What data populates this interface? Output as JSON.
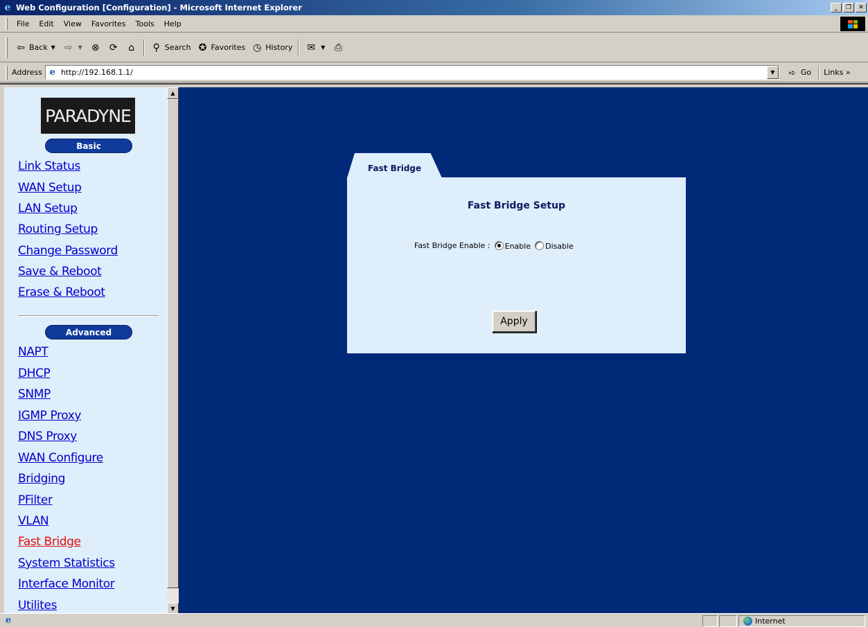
{
  "window": {
    "title": "Web Configuration [Configuration] - Microsoft Internet Explorer"
  },
  "menu": {
    "items": [
      {
        "label": "File"
      },
      {
        "label": "Edit"
      },
      {
        "label": "View"
      },
      {
        "label": "Favorites"
      },
      {
        "label": "Tools"
      },
      {
        "label": "Help"
      }
    ]
  },
  "toolbar": {
    "back": "Back",
    "search": "Search",
    "favorites": "Favorites",
    "history": "History"
  },
  "address": {
    "label": "Address",
    "url": "http://192.168.1.1/",
    "go": "Go",
    "links": "Links"
  },
  "sidebar": {
    "logo": "PARADYNE",
    "basic_header": "Basic",
    "basic_items": [
      {
        "label": "Link Status"
      },
      {
        "label": "WAN Setup"
      },
      {
        "label": "LAN Setup"
      },
      {
        "label": "Routing Setup"
      },
      {
        "label": "Change Password"
      },
      {
        "label": "Save & Reboot"
      },
      {
        "label": "Erase & Reboot"
      }
    ],
    "advanced_header": "Advanced",
    "advanced_items": [
      {
        "label": "NAPT"
      },
      {
        "label": "DHCP"
      },
      {
        "label": "SNMP"
      },
      {
        "label": "IGMP Proxy"
      },
      {
        "label": "DNS Proxy"
      },
      {
        "label": "WAN Configure"
      },
      {
        "label": "Bridging"
      },
      {
        "label": "PFilter"
      },
      {
        "label": "VLAN"
      },
      {
        "label": "Fast Bridge",
        "active": true
      },
      {
        "label": "System Statistics"
      },
      {
        "label": "Interface Monitor"
      },
      {
        "label": "Utilites"
      }
    ]
  },
  "panel": {
    "tab_label": "Fast Bridge",
    "title": "Fast Bridge Setup",
    "field_label": "Fast Bridge Enable :",
    "options": [
      {
        "label": "Enable",
        "checked": true
      },
      {
        "label": "Disable",
        "checked": false
      }
    ],
    "apply_label": "Apply"
  },
  "status": {
    "zone": "Internet"
  },
  "colors": {
    "main_bg": "#002a78",
    "sidebar_bg": "#dfeefb",
    "pill_bg": "#103a9c",
    "link": "#0000cc",
    "active_link": "#e01010"
  }
}
